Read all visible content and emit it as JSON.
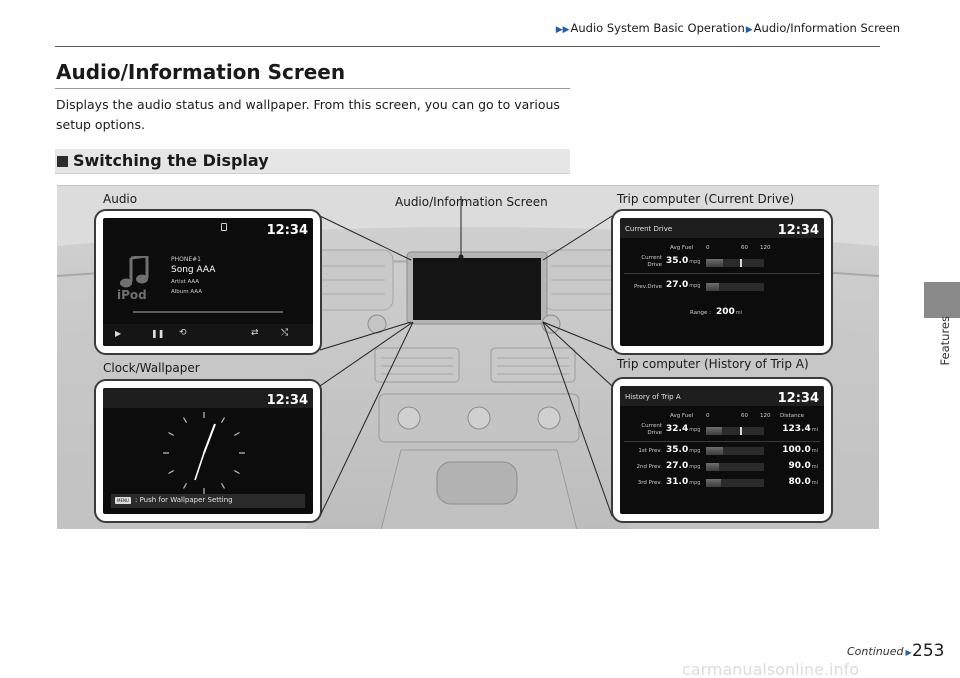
{
  "breadcrumb": {
    "part1": "Audio System Basic Operation",
    "part2": "Audio/Information Screen"
  },
  "side_tab": {
    "label": "Features"
  },
  "page": {
    "title": "Audio/Information Screen",
    "intro": "Displays the audio status and wallpaper. From this screen, you can go to various setup options.",
    "section_title": "Switching the Display",
    "page_number": "253",
    "continued": "Continued"
  },
  "figure": {
    "labels": {
      "audio": "Audio",
      "center": "Audio/Information Screen",
      "trip_current": "Trip computer (Current Drive)",
      "clock": "Clock/Wallpaper",
      "trip_history": "Trip computer (History of Trip A)"
    },
    "clock_time": "12:34",
    "audio_screen": {
      "source": "PHONE#1",
      "song": "Song AAA",
      "artist": "Artist AAA",
      "album": "Album AAA",
      "logo": "iPod"
    },
    "clock_screen": {
      "menu_key": "MENU",
      "hint": ": Push for Wallpaper Setting"
    },
    "current_drive": {
      "title": "Current Drive",
      "col_avg_fuel": "Avg Fuel",
      "scale": [
        "0",
        "60",
        "120"
      ],
      "rows": [
        {
          "label_1": "Current",
          "label_2": "Drive",
          "value": "35.0",
          "unit": "mpg",
          "fraction": 0.29
        },
        {
          "label_1": "Prev.Drive",
          "label_2": "",
          "value": "27.0",
          "unit": "mpg",
          "fraction": 0.23
        }
      ],
      "range_label": "Range :",
      "range_value": "200",
      "range_unit": "mi"
    },
    "history": {
      "title": "History of Trip A",
      "col_avg_fuel": "Avg Fuel",
      "col_distance": "Distance",
      "scale": [
        "0",
        "60",
        "120"
      ],
      "rows": [
        {
          "label_1": "Current",
          "label_2": "Drive",
          "value": "32.4",
          "unit": "mpg",
          "fraction": 0.27,
          "distance": "123.4",
          "dist_unit": "mi"
        },
        {
          "label_1": "1st Prev.",
          "label_2": "",
          "value": "35.0",
          "unit": "mpg",
          "fraction": 0.29,
          "distance": "100.0",
          "dist_unit": "mi"
        },
        {
          "label_1": "2nd Prev.",
          "label_2": "",
          "value": "27.0",
          "unit": "mpg",
          "fraction": 0.23,
          "distance": "90.0",
          "dist_unit": "mi"
        },
        {
          "label_1": "3rd Prev.",
          "label_2": "",
          "value": "31.0",
          "unit": "mpg",
          "fraction": 0.26,
          "distance": "80.0",
          "dist_unit": "mi"
        }
      ]
    }
  },
  "watermark": "carmanualsonline.info",
  "colors": {
    "accent": "#1f5fb0",
    "section_bar": "#e6e6e6",
    "side_tab": "#8a8a8a",
    "figure_bg": "#d9d9d9",
    "screen_bg": "#0c0c0c"
  }
}
